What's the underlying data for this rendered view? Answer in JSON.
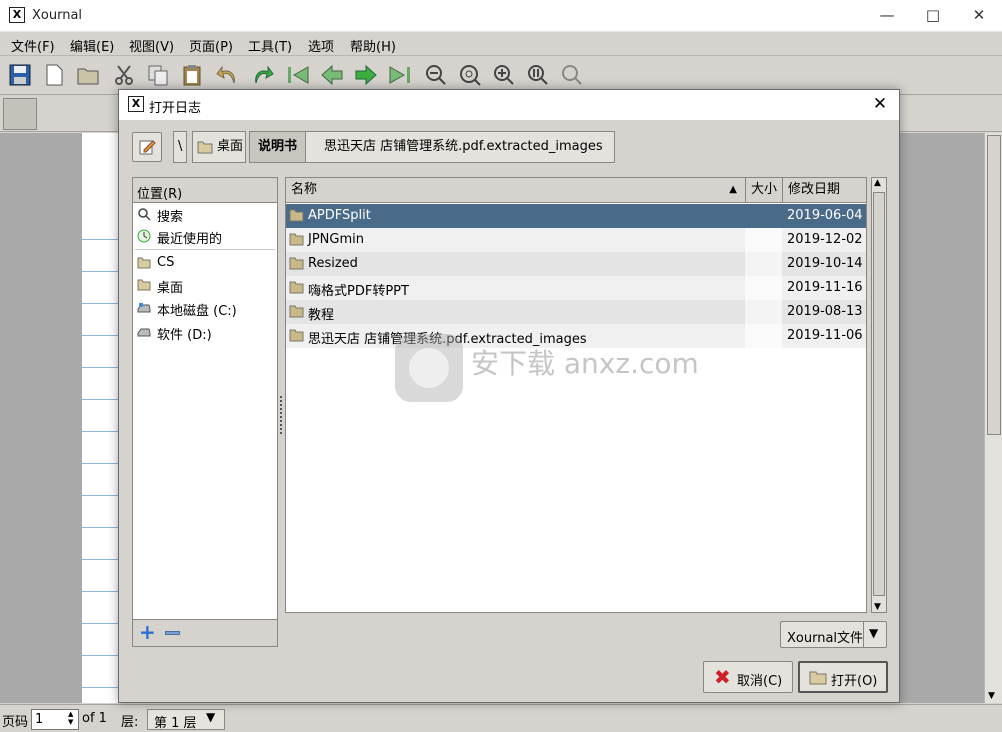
{
  "app": {
    "title": "Xournal",
    "icon_glyph": "X"
  },
  "menu": [
    "文件(F)",
    "编辑(E)",
    "视图(V)",
    "页面(P)",
    "工具(T)",
    "选项",
    "帮助(H)"
  ],
  "status": {
    "page_label": "页码",
    "page_value": "1",
    "of_label": "of 1",
    "layer_label": "层:",
    "layer_value": "第 1 层"
  },
  "dialog": {
    "title": "打开日志",
    "breadcrumb": [
      "\\",
      "桌面",
      "说明书",
      "思迅天店 店铺管理系统.pdf.extracted_images"
    ],
    "places_header": "位置(R)",
    "places": [
      {
        "label": "搜索",
        "icon": "search-icon"
      },
      {
        "label": "最近使用的",
        "icon": "recent-icon"
      },
      {
        "label": "CS",
        "icon": "folder-icon"
      },
      {
        "label": "桌面",
        "icon": "folder-icon"
      },
      {
        "label": "本地磁盘 (C:)",
        "icon": "drive-icon"
      },
      {
        "label": "软件 (D:)",
        "icon": "drive-icon"
      }
    ],
    "columns": {
      "name": "名称",
      "size": "大小",
      "date": "修改日期"
    },
    "files": [
      {
        "name": "APDFSplit",
        "date": "2019-06-04",
        "selected": true
      },
      {
        "name": "JPNGmin",
        "date": "2019-12-02",
        "selected": false
      },
      {
        "name": "Resized",
        "date": "2019-10-14",
        "selected": false
      },
      {
        "name": "嗨格式PDF转PPT",
        "date": "2019-11-16",
        "selected": false
      },
      {
        "name": "教程",
        "date": "2019-08-13",
        "selected": false
      },
      {
        "name": "思迅天店 店铺管理系统.pdf.extracted_images",
        "date": "2019-11-06",
        "selected": false
      }
    ],
    "filter": "Xournal文件",
    "cancel_label": "取消(C)",
    "open_label": "打开(O)",
    "watermark": "安下载 anxz.com"
  },
  "colors": {
    "selection": "#4a6a8a",
    "cancel_icon": "#d0202a",
    "folder": "#c9b98a"
  }
}
